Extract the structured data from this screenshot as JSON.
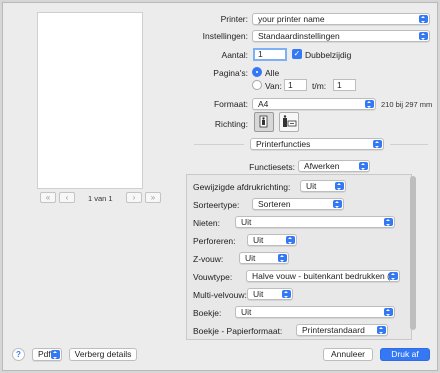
{
  "printer": {
    "label": "Printer:",
    "value": "your printer name"
  },
  "presets": {
    "label": "Instellingen:",
    "value": "Standaardinstellingen"
  },
  "copies": {
    "label": "Aantal:",
    "value": "1",
    "duplex_label": "Dubbelzijdig",
    "duplex_checked": true
  },
  "pages": {
    "label": "Pagina's:",
    "all_label": "Alle",
    "from_label": "Van:",
    "from_value": "1",
    "to_label": "t/m:",
    "to_value": "1"
  },
  "paper": {
    "label": "Formaat:",
    "value": "A4",
    "size_text": "210 bij 297 mm"
  },
  "orientation": {
    "label": "Richting:",
    "selected": "portrait"
  },
  "section_popup": {
    "value": "Printerfuncties"
  },
  "feature_sets": {
    "label": "Functiesets:",
    "value": "Afwerken"
  },
  "features": [
    {
      "label": "Gewijzigde afdrukrichting:",
      "value": "Uit"
    },
    {
      "label": "Sorteertype:",
      "value": "Sorteren"
    },
    {
      "label": "Nieten:",
      "value": "Uit"
    },
    {
      "label": "Perforeren:",
      "value": "Uit"
    },
    {
      "label": "Z-vouw:",
      "value": "Uit"
    },
    {
      "label": "Vouwtype:",
      "value": "Halve vouw - buitenkant bedrukken (…"
    },
    {
      "label": "Multi-velvouw:",
      "value": "Uit"
    },
    {
      "label": "Boekje:",
      "value": "Uit"
    },
    {
      "label": "Boekje - Papierformaat:",
      "value": "Printerstandaard"
    }
  ],
  "preview_nav": {
    "page_text": "1 van 1"
  },
  "footer": {
    "help": "?",
    "pdf_label": "Pdf",
    "details_label": "Verberg details",
    "cancel_label": "Annuleer",
    "print_label": "Druk af"
  },
  "colors": {
    "accent": "#3478f6"
  }
}
